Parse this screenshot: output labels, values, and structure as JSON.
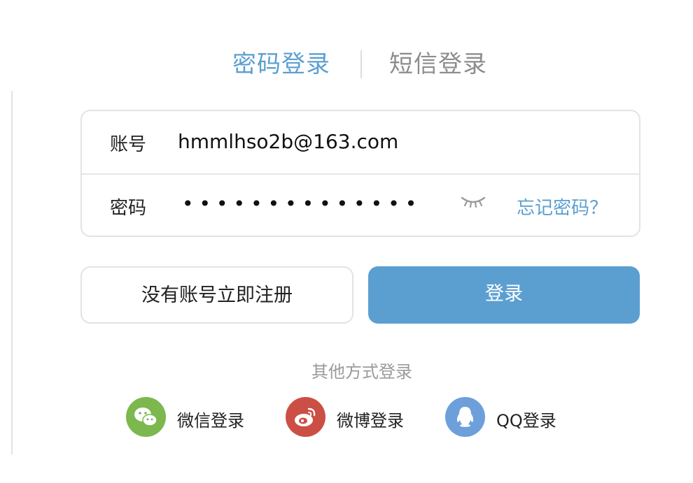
{
  "tabs": {
    "password_login": "密码登录",
    "sms_login": "短信登录"
  },
  "form": {
    "account_label": "账号",
    "account_value": "hmmlhso2b@163.com",
    "password_label": "密码",
    "password_masked": "••••••••••••••",
    "toggle_icon": "eye-closed-icon",
    "forgot_link": "忘记密码？"
  },
  "buttons": {
    "register": "没有账号立即注册",
    "login": "登录"
  },
  "other_login": {
    "title": "其他方式登录",
    "wechat": "微信登录",
    "weibo": "微博登录",
    "qq": "QQ登录"
  },
  "colors": {
    "accent": "#5b9fd1",
    "wechat": "#7cb84e",
    "weibo": "#cc4f45",
    "qq": "#6d9fdb"
  }
}
